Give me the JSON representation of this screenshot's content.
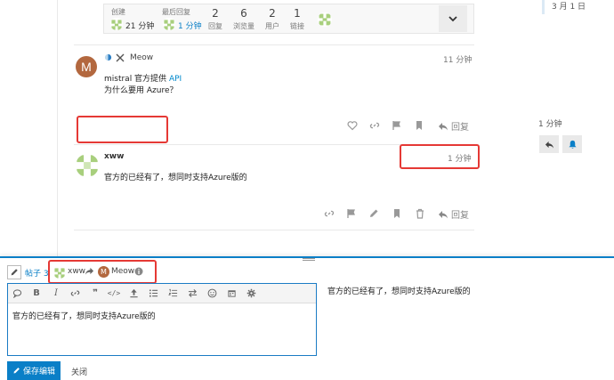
{
  "stats": {
    "created_label": "创建",
    "created_value": "21 分钟",
    "last_reply_label": "最后回复",
    "last_reply_value": "1 分钟",
    "replies_count": "2",
    "replies_label": "回复",
    "views_count": "6",
    "views_label": "浏览量",
    "users_count": "2",
    "users_label": "用户",
    "links_count": "1",
    "links_label": "链接"
  },
  "posts": [
    {
      "username": "Meow",
      "avatar_letter": "M",
      "time": "11 分钟",
      "line1_prefix": "mistral 官方提供 ",
      "line1_link": "API",
      "line2": "为什么要用 Azure？",
      "reply_label": "回复"
    },
    {
      "username": "xww",
      "time": "1 分钟",
      "text": "官方的已经有了，想同时支持Azure版的",
      "reply_label": "回复"
    }
  ],
  "timeline": {
    "date": "3 月 1 日",
    "time": "1 分钟"
  },
  "composer": {
    "post_label": "帖子 3",
    "reply_from": "xww",
    "reply_to": "Meow",
    "editor_text": "官方的已经有了，想同时支持Azure版的",
    "preview_text": "官方的已经有了，想同时支持Azure版的",
    "save_label": "保存编辑",
    "close_label": "关闭"
  },
  "colors": {
    "accent": "#0a7fc7",
    "highlight_box": "#e53935",
    "meow_avatar": "#b3683f",
    "identicon": "#a8cf7d"
  }
}
